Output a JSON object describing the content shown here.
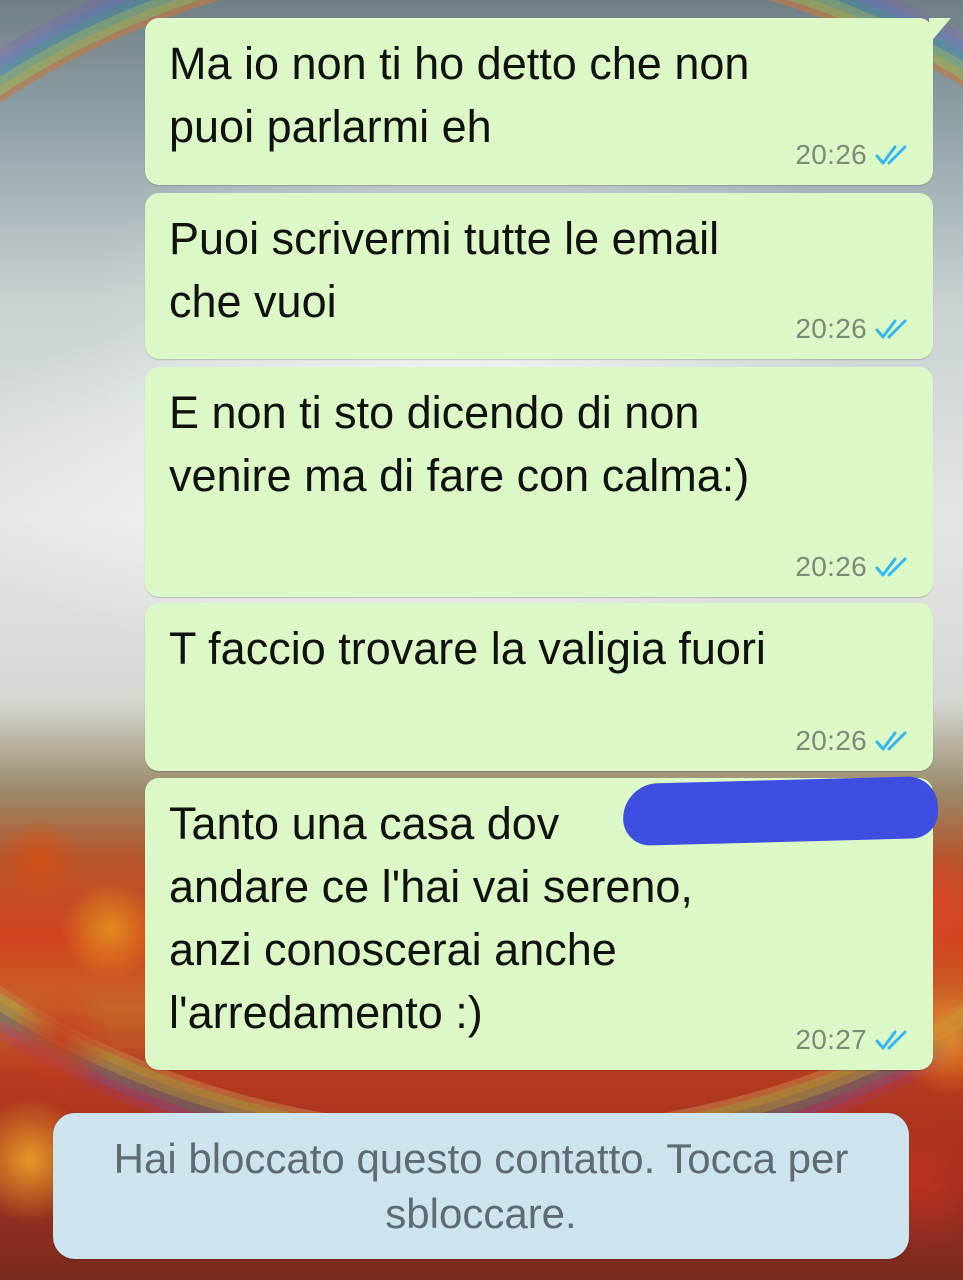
{
  "conversation": {
    "messages": [
      {
        "text": "Ma io non ti ho detto che non\npuoi parlarmi eh",
        "time": "20:26",
        "status": "read"
      },
      {
        "text": "Puoi scrivermi tutte le email\nche vuoi",
        "time": "20:26",
        "status": "read"
      },
      {
        "text": "E non ti sto dicendo di non\nvenire ma di fare con calma:)",
        "time": "20:26",
        "status": "read"
      },
      {
        "text": "T faccio trovare la valigia fuori",
        "time": "20:26",
        "status": "read"
      },
      {
        "text": "Tanto una casa dov\nandare ce l'hai vai sereno,\nanzi conoscerai anche\nl'arredamento :)",
        "time": "20:27",
        "status": "read"
      }
    ]
  },
  "blocked_banner": {
    "label": "Hai bloccato questo contatto. Tocca per sbloccare."
  },
  "colors": {
    "outgoing_bubble": "#dcf8c6",
    "timestamp": "#7e8a78",
    "read_ticks": "#34b7f1",
    "banner_background": "#cde4ef",
    "banner_text": "#5f6b70",
    "redaction": "#3d4ee0"
  },
  "icons": {
    "read_receipt": "double-check-icon"
  }
}
